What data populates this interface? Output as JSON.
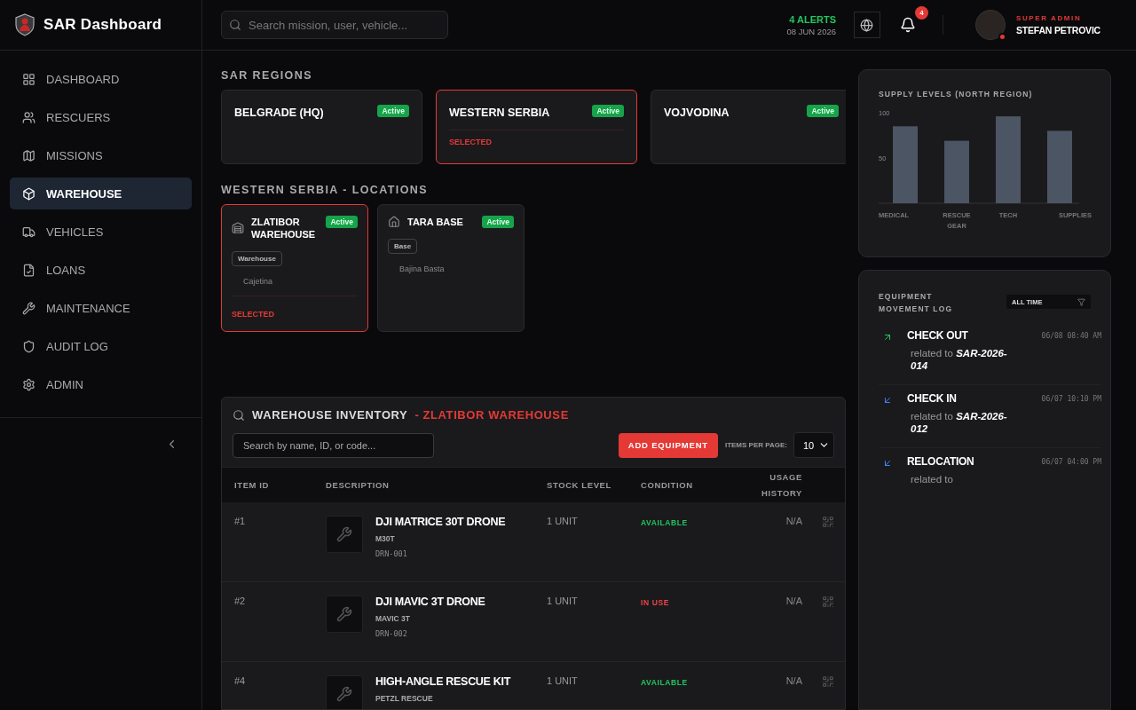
{
  "app": {
    "title": "SAR Dashboard"
  },
  "header": {
    "search": {
      "placeholder": "Search mission, user, vehicle..."
    },
    "alerts": "4 ALERTS",
    "date": "08 JUN 2026",
    "notifications": "4",
    "user": {
      "role": "SUPER ADMIN",
      "name": "STEFAN PETROVIC",
      "online": true
    }
  },
  "sidebar": {
    "items": [
      {
        "label": "DASHBOARD",
        "selected": false
      },
      {
        "label": "RESCUERS",
        "selected": false
      },
      {
        "label": "MISSIONS",
        "selected": false
      },
      {
        "label": "WAREHOUSE",
        "selected": true
      },
      {
        "label": "VEHICLES",
        "selected": false
      },
      {
        "label": "LOANS",
        "selected": false
      },
      {
        "label": "MAINTENANCE",
        "selected": false
      },
      {
        "label": "AUDIT LOG",
        "selected": false
      },
      {
        "label": "ADMIN",
        "selected": false
      }
    ]
  },
  "regions": {
    "title": "SAR REGIONS",
    "items": [
      {
        "name": "BELGRADE (HQ)",
        "status": "Active",
        "selected": false
      },
      {
        "name": "WESTERN SERBIA",
        "status": "Active",
        "selected": true,
        "note": "SELECTED"
      },
      {
        "name": "VOJVODINA",
        "status": "Active",
        "selected": false
      }
    ]
  },
  "locations": {
    "title": "WESTERN SERBIA - LOCATIONS",
    "items": [
      {
        "kind": "warehouse",
        "name": "ZLATIBOR WAREHOUSE",
        "status": "Active",
        "tag": "Warehouse",
        "city": "Cajetina",
        "selected": true,
        "note": "SELECTED"
      },
      {
        "kind": "base",
        "name": "TARA BASE",
        "status": "Active",
        "tag": "Base",
        "city": "Bajina Basta",
        "selected": false
      }
    ]
  },
  "inventory": {
    "title": "WAREHOUSE INVENTORY",
    "subtitle": "- ZLATIBOR WAREHOUSE",
    "search": {
      "placeholder": "Search by name, ID, or code..."
    },
    "add_button": "ADD EQUIPMENT",
    "per_page_label": "ITEMS PER PAGE:",
    "per_page": "10",
    "columns": [
      "ITEM ID",
      "DESCRIPTION",
      "STOCK LEVEL",
      "CONDITION",
      "USAGE HISTORY"
    ],
    "rows": [
      {
        "id": "#1",
        "name": "DJI MATRICE 30T DRONE",
        "model": "M30T",
        "code": "DRN-001",
        "stock": "1 UNIT",
        "condition": "AVAILABLE",
        "kind": "available",
        "usage": "N/A"
      },
      {
        "id": "#2",
        "name": "DJI MAVIC 3T DRONE",
        "model": "MAVIC 3T",
        "code": "DRN-002",
        "stock": "1 UNIT",
        "condition": "IN USE",
        "kind": "in_use",
        "usage": "N/A"
      },
      {
        "id": "#4",
        "name": "HIGH-ANGLE RESCUE KIT",
        "model": "PETZL RESCUE",
        "stock": "1 UNIT",
        "condition": "AVAILABLE",
        "kind": "available",
        "usage": "N/A"
      }
    ]
  },
  "supply": {
    "chart_data": {
      "type": "bar",
      "title": "SUPPLY LEVELS (NORTH REGION)",
      "categories": [
        "MEDICAL",
        "RESCUE GEAR",
        "TECH",
        "SUPPLIES"
      ],
      "values": [
        85,
        69,
        96,
        80
      ],
      "ylim": [
        0,
        100
      ],
      "yticks": [
        50,
        100
      ]
    }
  },
  "movement_log": {
    "title": "EQUIPMENT MOVEMENT LOG",
    "filter": "ALL TIME",
    "entries": [
      {
        "kind": "check_out",
        "action": "CHECK OUT",
        "related": "related to",
        "ref": "SAR-2026-014",
        "time": "06/08 08:40 AM"
      },
      {
        "kind": "check_in",
        "action": "CHECK IN",
        "related": "related to",
        "ref": "SAR-2026-012",
        "time": "06/07 10:10 PM"
      },
      {
        "kind": "relocation",
        "action": "RELOCATION",
        "related": "related to",
        "time": "06/07 04:00 PM"
      }
    ]
  }
}
